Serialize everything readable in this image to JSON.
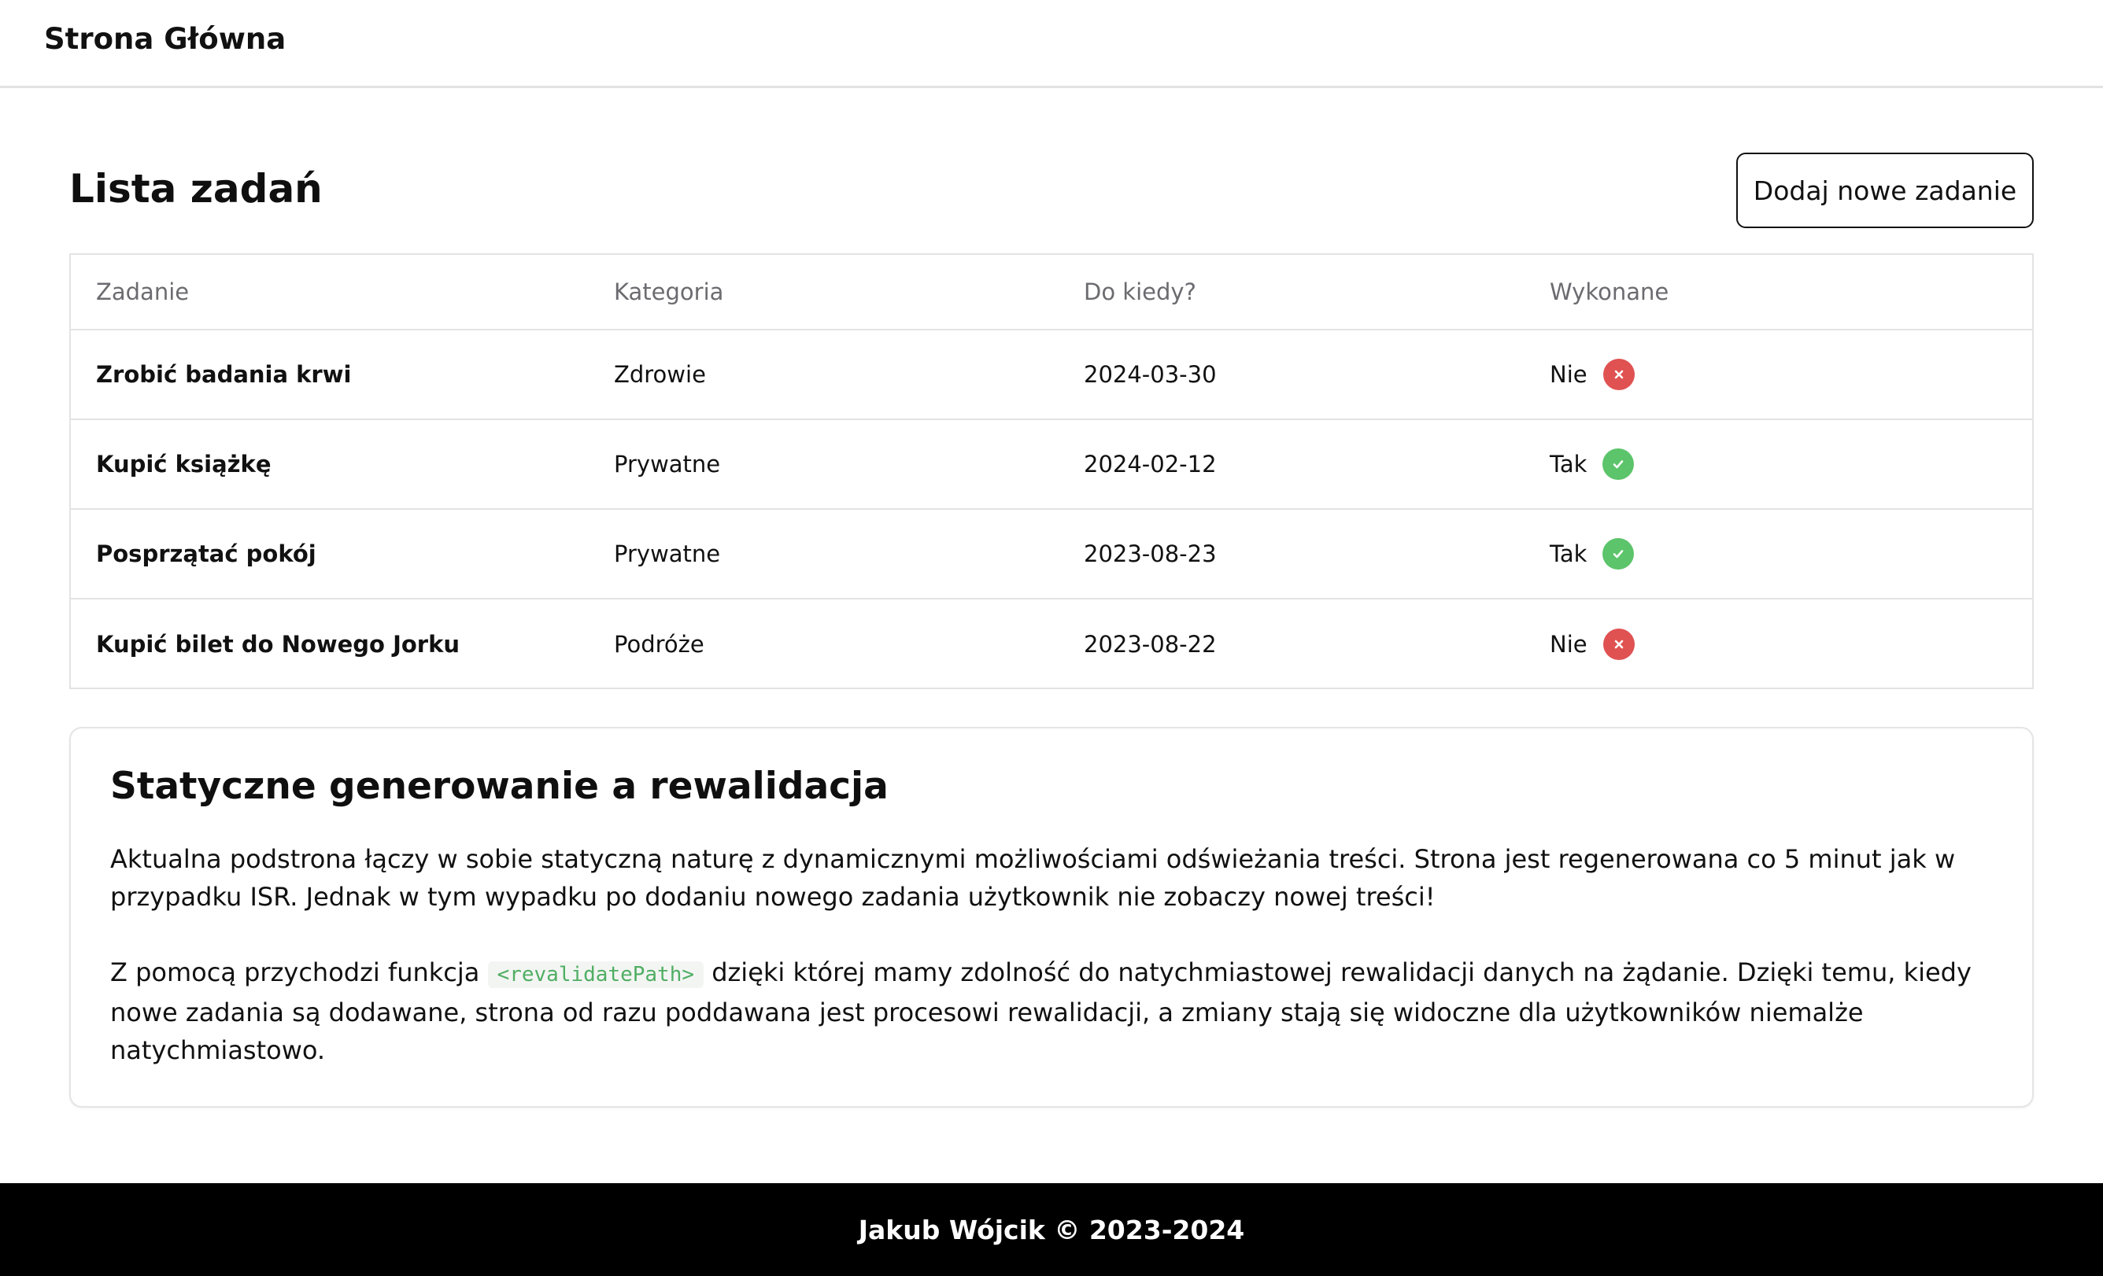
{
  "header": {
    "brand": "Strona Główna"
  },
  "main": {
    "title": "Lista zadań",
    "add_button_label": "Dodaj nowe zadanie"
  },
  "table": {
    "columns": [
      "Zadanie",
      "Kategoria",
      "Do kiedy?",
      "Wykonane"
    ],
    "rows": [
      {
        "task": "Zrobić badania krwi",
        "category": "Zdrowie",
        "deadline": "2024-03-30",
        "done_label": "Nie",
        "done": false
      },
      {
        "task": "Kupić książkę",
        "category": "Prywatne",
        "deadline": "2024-02-12",
        "done_label": "Tak",
        "done": true
      },
      {
        "task": "Posprzątać pokój",
        "category": "Prywatne",
        "deadline": "2023-08-23",
        "done_label": "Tak",
        "done": true
      },
      {
        "task": "Kupić bilet do Nowego Jorku",
        "category": "Podróże",
        "deadline": "2023-08-22",
        "done_label": "Nie",
        "done": false
      }
    ]
  },
  "info": {
    "title": "Statyczne generowanie a rewalidacja",
    "paragraph1": "Aktualna podstrona łączy w sobie statyczną naturę z dynamicznymi możliwościami odświeżania treści. Strona jest regenerowana co 5 minut jak w przypadku ISR. Jednak w tym wypadku po dodaniu nowego zadania użytkownik nie zobaczy nowej treści!",
    "paragraph2_before": "Z pomocą przychodzi funkcja ",
    "paragraph2_code": "<revalidatePath>",
    "paragraph2_after": " dzięki której mamy zdolność do natychmiastowej rewalidacji danych na żądanie. Dzięki temu, kiedy nowe zadania są dodawane, strona od razu poddawana jest procesowi rewalidacji, a zmiany stają się widoczne dla użytkowników niemalże natychmiastowo."
  },
  "footer": {
    "text": "Jakub Wójcik © 2023-2024"
  },
  "colors": {
    "status_no": "#e05252",
    "status_yes": "#5cc46a",
    "code_text": "#4fae63"
  },
  "icons": {
    "status_no": "x-circle-icon",
    "status_yes": "check-circle-icon"
  }
}
